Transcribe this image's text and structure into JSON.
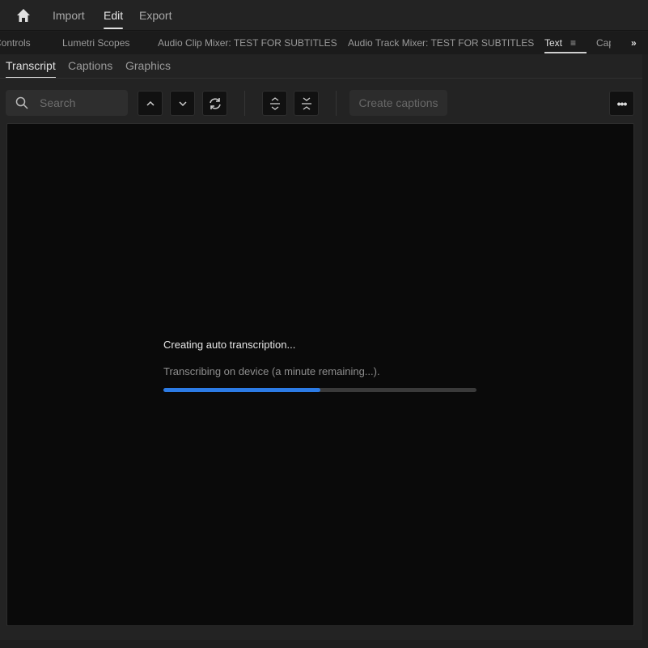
{
  "topbar": {
    "icon": "home-icon",
    "items": [
      {
        "label": "Import"
      },
      {
        "label": "Edit",
        "active": true
      },
      {
        "label": "Export"
      }
    ]
  },
  "panel_tabs": {
    "items": [
      "Controls",
      "Lumetri Scopes",
      "Audio Clip Mixer: TEST FOR SUBTITLES",
      "Audio Track Mixer: TEST FOR SUBTITLES",
      "Text",
      "Cap"
    ],
    "active": "Text",
    "more_icon": "double-chevron-right-icon"
  },
  "sub_tabs": {
    "items": [
      "Transcript",
      "Captions",
      "Graphics"
    ],
    "active": "Transcript"
  },
  "toolbar": {
    "search_placeholder": "Search",
    "create_captions": "Create captions",
    "icons": [
      "search-icon",
      "chevron-up-icon",
      "chevron-down-icon",
      "refresh-icon",
      "expand-icon",
      "collapse-icon",
      "more-icon"
    ]
  },
  "status": {
    "title": "Creating auto transcription...",
    "detail": "Transcribing on device (a minute remaining...).",
    "progress_percent": 50,
    "progress_color": "#2c7be5"
  }
}
